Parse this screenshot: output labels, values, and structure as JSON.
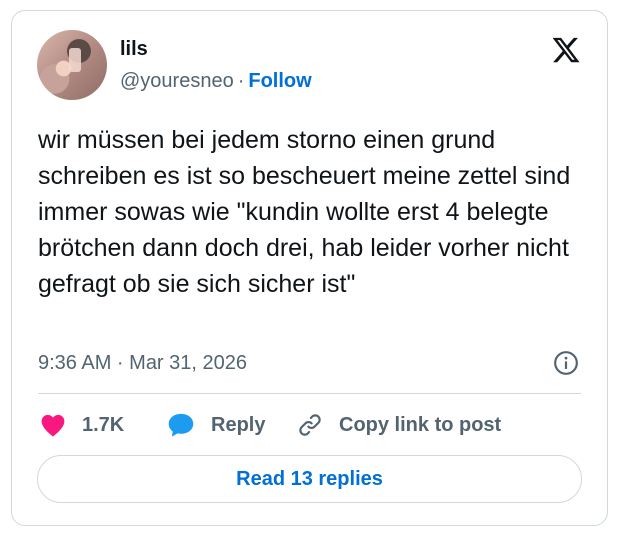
{
  "author": {
    "display_name": "lils",
    "handle": "@youresneo",
    "separator": "·",
    "follow_label": "Follow"
  },
  "tweet": {
    "text": "wir müssen bei jedem storno einen grund schreiben es ist so bescheuert meine zettel sind immer sowas wie \"kundin wollte erst 4 belegte brötchen dann doch drei, hab leider vorher nicht gefragt ob sie sich sicher ist\"",
    "timestamp": "9:36 AM · Mar 31, 2026"
  },
  "actions": {
    "likes_count": "1.7K",
    "reply_label": "Reply",
    "copy_link_label": "Copy link to post"
  },
  "read_replies_label": "Read 13 replies",
  "icons": {
    "logo": "x-logo-icon",
    "info": "info-icon",
    "like": "heart-icon",
    "reply": "speech-bubble-icon",
    "copy": "link-icon"
  },
  "colors": {
    "accent": "#006fd6",
    "like": "#f91880",
    "reply": "#1d9bf0",
    "secondary_text": "#536471",
    "border": "#cfd9de"
  }
}
